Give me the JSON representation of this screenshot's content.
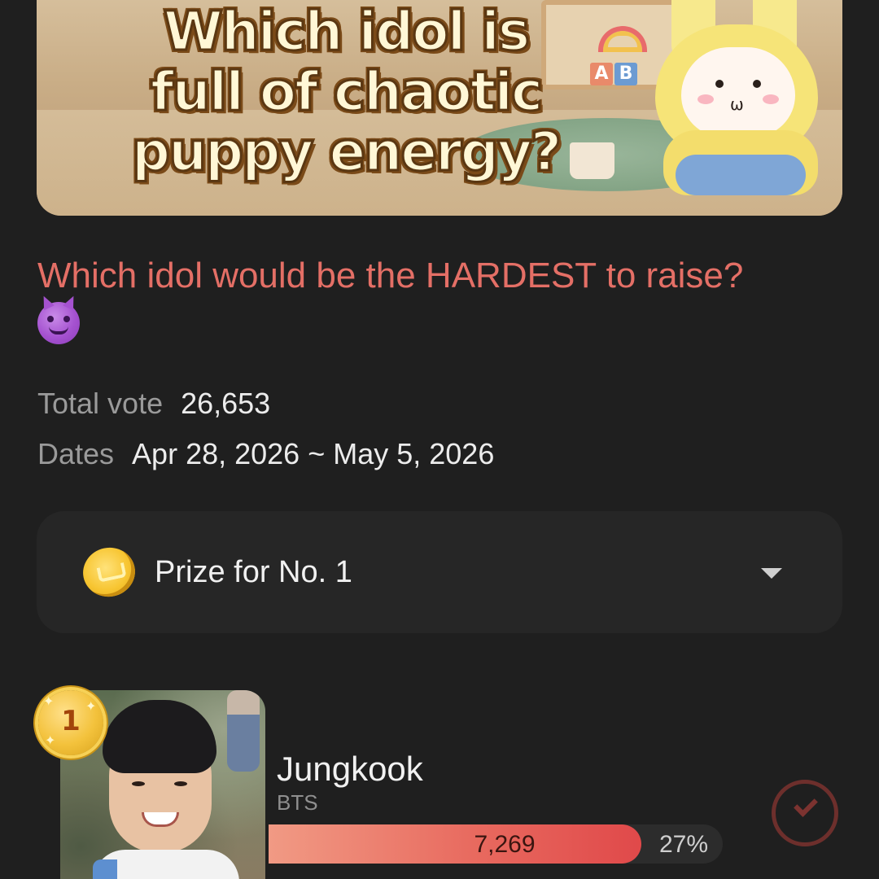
{
  "banner": {
    "title_lines": [
      "Which idol is",
      "full of chaotic",
      "puppy energy?"
    ],
    "blocks": [
      "A",
      "B"
    ]
  },
  "question": {
    "text": "Which idol would be the HARDEST to raise?",
    "emoji": "smiling-face-with-horns-icon"
  },
  "meta": {
    "total_vote_label": "Total vote",
    "total_vote_value": "26,653",
    "dates_label": "Dates",
    "dates_value": "Apr 28, 2026 ~ May 5, 2026"
  },
  "prize": {
    "label": "Prize for No. 1",
    "icon": "coin-icon",
    "expand_icon": "chevron-down-icon"
  },
  "candidates": [
    {
      "rank": "1",
      "name": "Jungkook",
      "group": "BTS",
      "votes": "7,269",
      "percent": "27%",
      "bar_fraction": 0.82,
      "selected": true
    }
  ],
  "colors": {
    "background": "#1f1f1f",
    "accent": "#e46f66",
    "panel": "#262626",
    "bar_start": "#f19a84",
    "bar_end": "#e0494a"
  }
}
